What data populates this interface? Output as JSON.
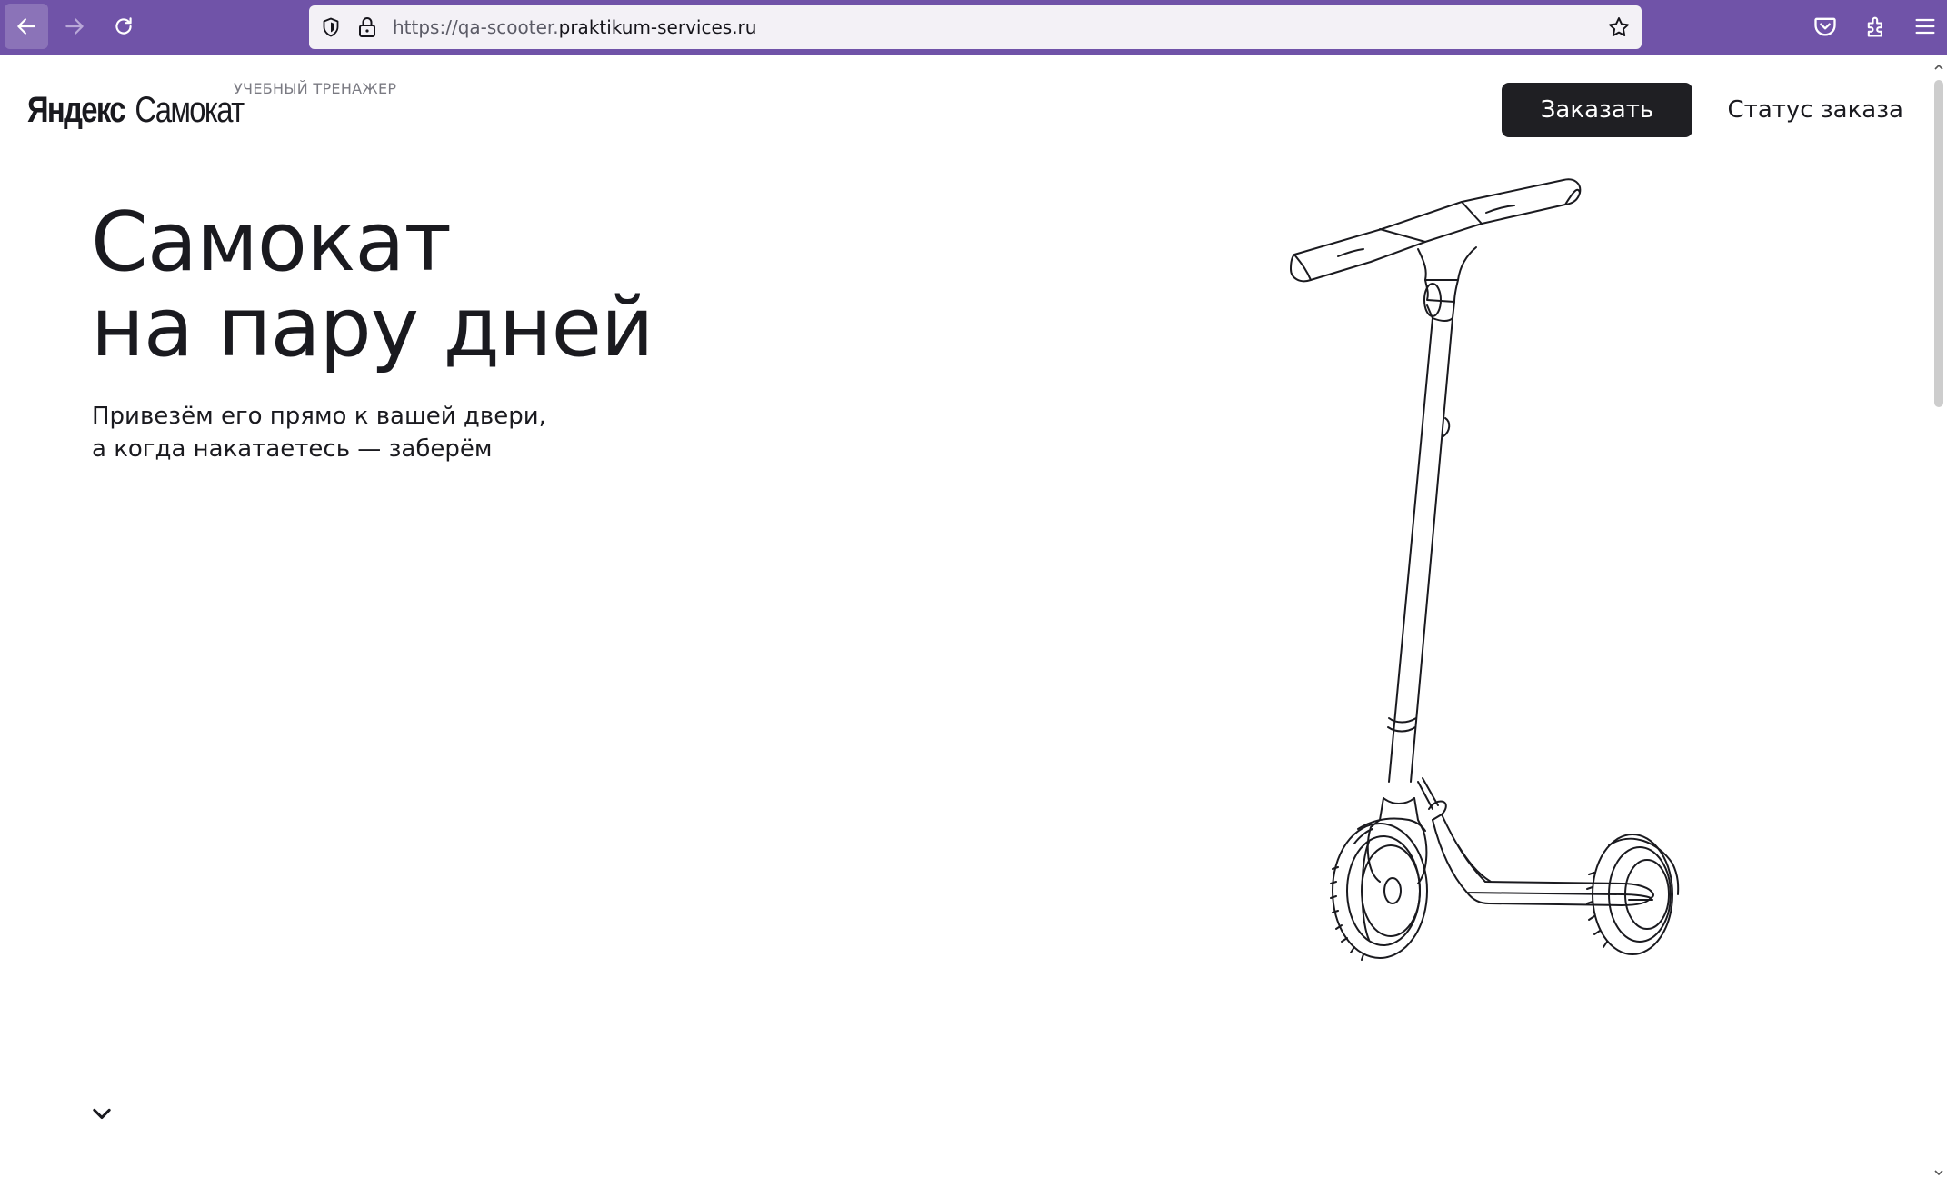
{
  "browser": {
    "url_prefix": "https://qa-scooter.",
    "url_domain": "praktikum-services.ru",
    "accent_color": "#7053a8",
    "icons": [
      "back-icon",
      "forward-icon",
      "reload-icon",
      "shield-icon",
      "lock-icon",
      "star-icon",
      "pocket-icon",
      "extensions-icon",
      "menu-icon"
    ]
  },
  "header": {
    "logo_brand": "Яндекс",
    "logo_product": "Самокат",
    "logo_subtitle": "УЧЕБНЫЙ ТРЕНАЖЕР",
    "order_button": "Заказать",
    "status_button": "Статус заказа"
  },
  "hero": {
    "title_line1": "Самокат",
    "title_line2": "на пару дней",
    "subtitle_line1": "Привезём его прямо к вашей двери,",
    "subtitle_line2": "а когда накатаетесь — заберём",
    "image": "scooter-illustration",
    "scroll_icon": "chevron-down-icon"
  }
}
